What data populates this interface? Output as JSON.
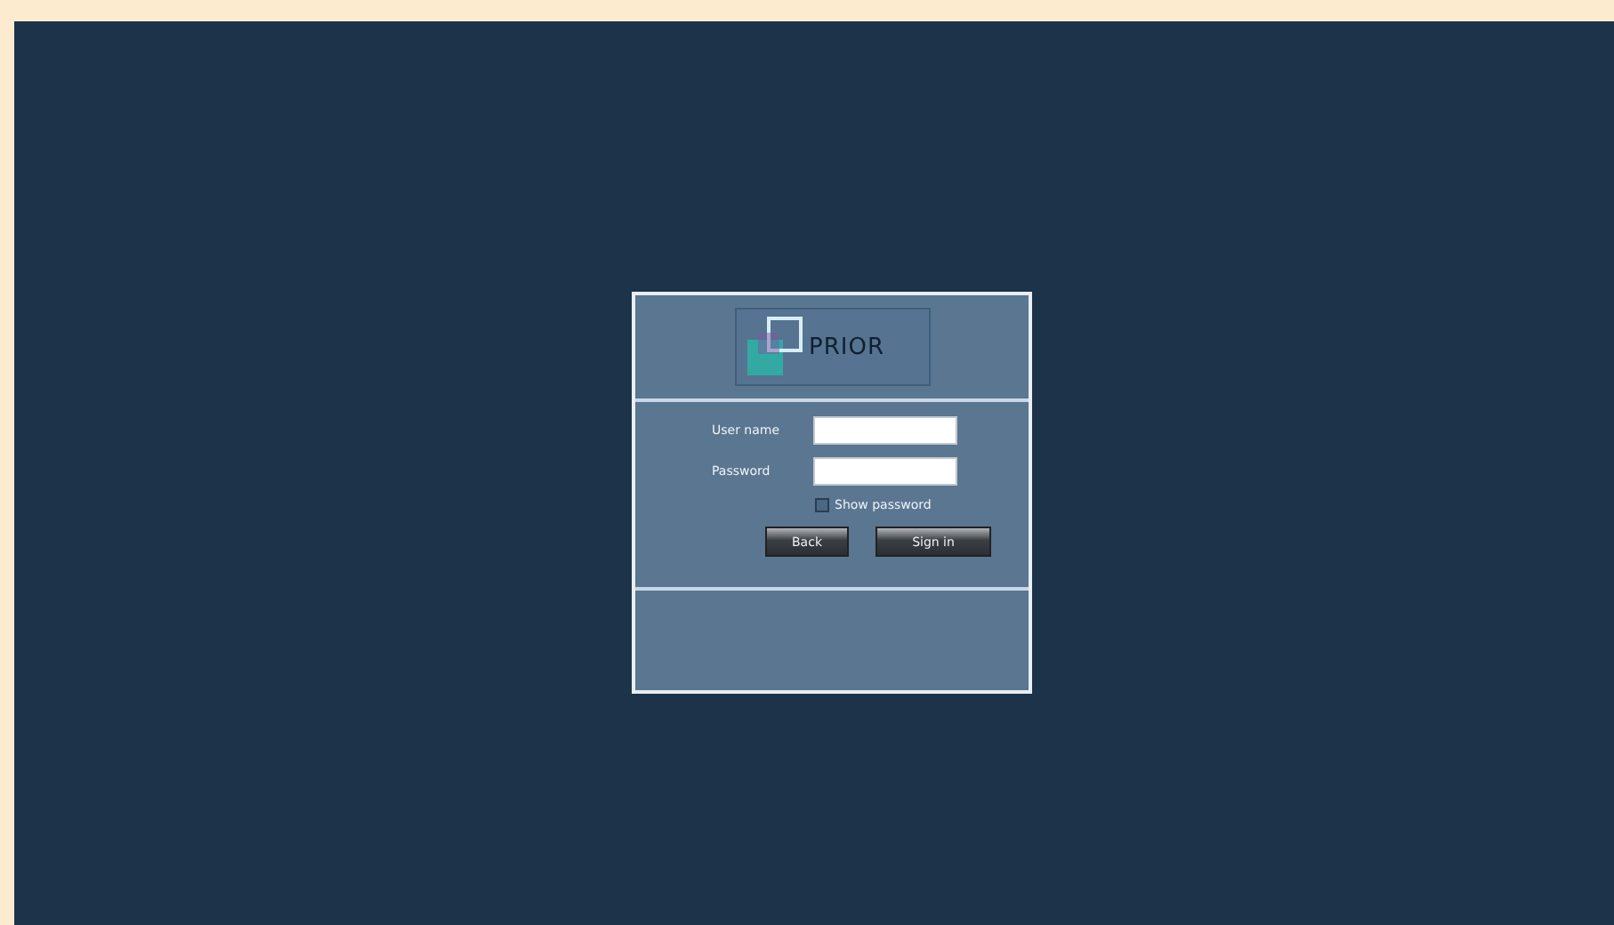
{
  "logo": {
    "text": "PRIOR"
  },
  "form": {
    "username_label": "User name",
    "password_label": "Password",
    "show_password": {
      "label": "Show password",
      "checked": false
    }
  },
  "buttons": [
    {
      "label": "Back",
      "kind": "back"
    },
    {
      "label": "Sign in",
      "kind": "submit"
    }
  ]
}
